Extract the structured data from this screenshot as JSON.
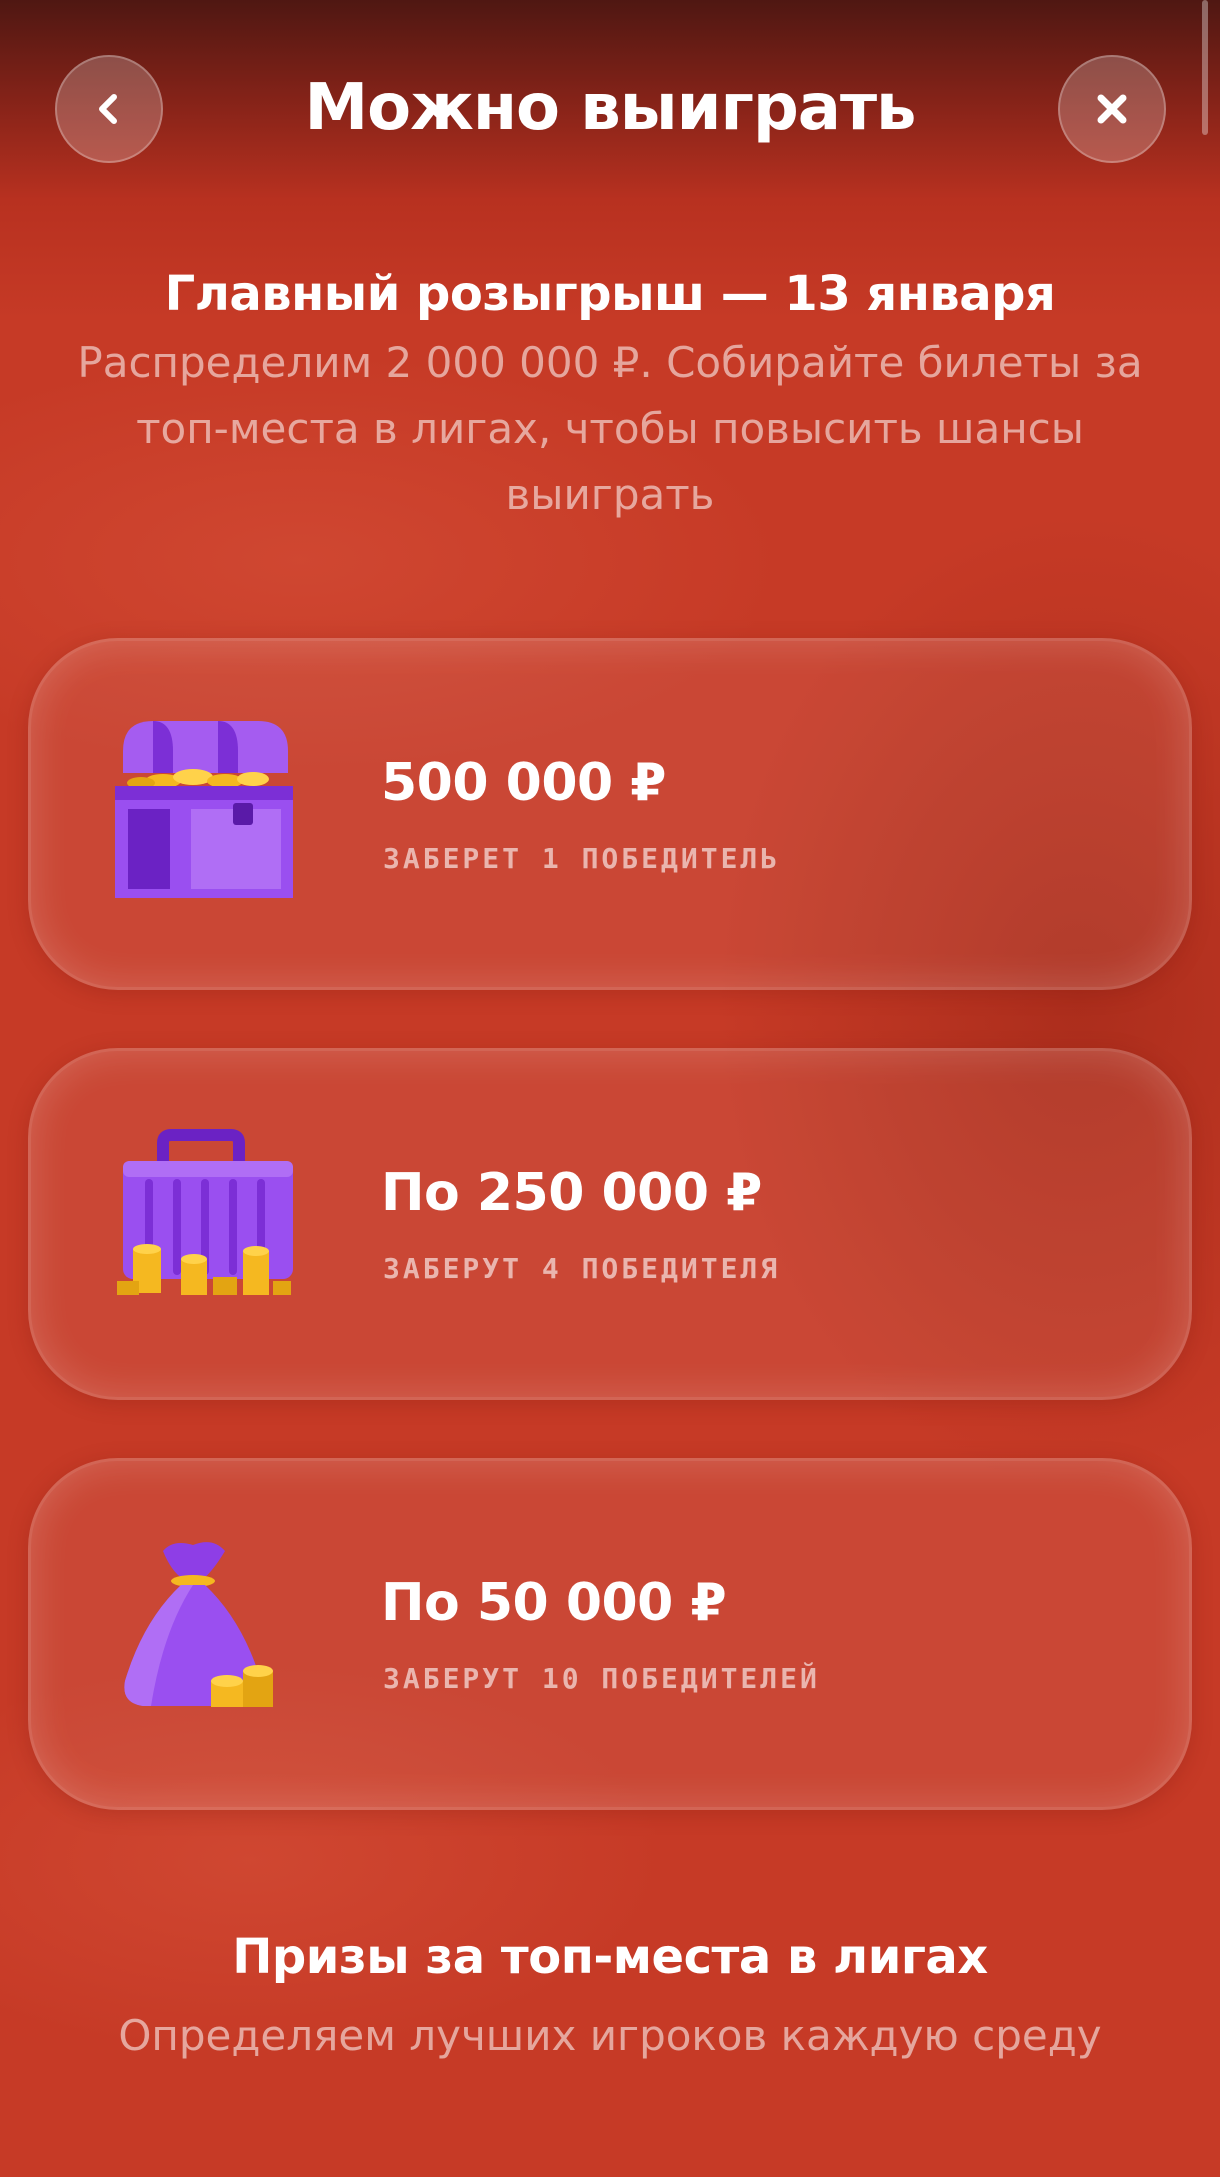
{
  "header": {
    "title": "Можно выиграть",
    "back_icon": "chevron-left-icon",
    "close_icon": "close-icon"
  },
  "intro": {
    "title": "Главный розыгрыш — 13 января",
    "subtitle": "Распределим 2 000 000 ₽. Собирайте билеты за топ-места в лигах, чтобы повысить шансы выиграть"
  },
  "prizes": [
    {
      "icon": "treasure-chest-icon",
      "amount": "500 000 ₽",
      "winners": "ЗАБЕРЕТ 1 ПОБЕДИТЕЛЬ"
    },
    {
      "icon": "money-case-icon",
      "amount": "По 250 000 ₽",
      "winners": "ЗАБЕРУТ 4 ПОБЕДИТЕЛЯ"
    },
    {
      "icon": "money-bag-icon",
      "amount": "По 50 000 ₽",
      "winners": "ЗАБЕРУТ 10 ПОБЕДИТЕЛЕЙ"
    }
  ],
  "league": {
    "title": "Призы за топ-места в лигах",
    "subtitle": "Определяем лучших игроков каждую среду"
  },
  "colors": {
    "background": "#c63a26",
    "header_dark": "#4f1712",
    "accent_purple": "#8e3ee6",
    "coin_gold": "#f5b820"
  }
}
